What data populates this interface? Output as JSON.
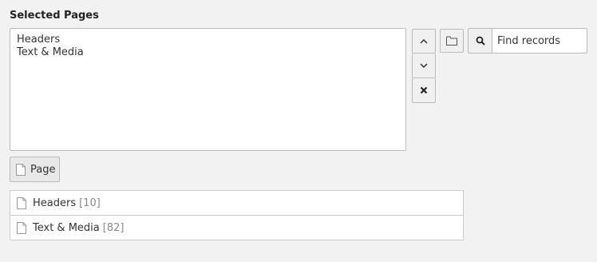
{
  "field": {
    "label": "Selected Pages",
    "selected_items": [
      "Headers",
      "Text & Media"
    ]
  },
  "controls": {
    "move_up_icon": "chevron-up-icon",
    "move_down_icon": "chevron-down-icon",
    "remove_icon": "close-icon",
    "browse_icon": "folder-icon",
    "search_icon": "search-icon",
    "find_placeholder": "Find records"
  },
  "add_button": {
    "label": "Page",
    "icon": "page-icon"
  },
  "records": [
    {
      "title": "Headers",
      "uid": "[10]"
    },
    {
      "title": "Text & Media",
      "uid": "[82]"
    }
  ]
}
